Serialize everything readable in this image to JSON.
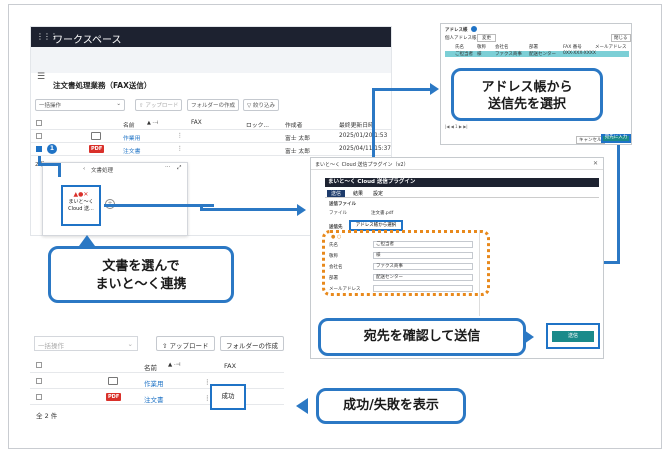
{
  "workspace": {
    "header_title": "ワークスペース",
    "page_title": "注文書処理業務（FAX送信）",
    "bulk_select": "一括操作",
    "upload_label": "アップロード",
    "create_folder_label": "フォルダーの作成",
    "filter_label": "絞り込み",
    "columns": [
      "名前",
      "FAX",
      "ロック...",
      "作成者",
      "最終更新日時"
    ],
    "rows": [
      {
        "name": "作業用",
        "fax": "",
        "creator": "富士 太郎",
        "updated": "2025/01/20 1:53"
      },
      {
        "name": "注文書",
        "fax": "",
        "creator": "富士 太郎",
        "updated": "2025/04/11 15:37"
      }
    ],
    "badge_count": "1",
    "count_partial": "2 件"
  },
  "doc_process": {
    "title": "文書処理",
    "app_label_1": "まいと～く",
    "app_label_2": "Cloud 送..."
  },
  "callouts": {
    "select_doc": [
      "文書を選んで",
      "まいと～く連携"
    ],
    "address_book": [
      "アドレス帳から",
      "送信先を選択"
    ],
    "confirm_send": "宛先を確認して送信",
    "show_result": "成功/失敗を表示"
  },
  "address_book": {
    "title": "アドレス帳",
    "group_label": "個人アドレス帳",
    "change_label": "変更",
    "close_label": "閉じる",
    "columns": [
      "氏名",
      "敬称",
      "会社名",
      "部署",
      "FAX 番号",
      "メールアドレス"
    ],
    "row": [
      "ご担当者",
      "様",
      "ファクス商事",
      "配送センター",
      "0XX-XXX-XXXX",
      ""
    ],
    "cancel_label": "キャンセル",
    "register_label": "宛先に入力"
  },
  "plugin": {
    "window_title": "まいと～く Cloud 送信プラグイン（v2）",
    "banner": "まいと～く Cloud 送信プラグイン",
    "tabs": [
      "送信",
      "結果",
      "設定"
    ],
    "send_file_heading": "送信ファイル",
    "file_label": "ファイル",
    "file_value": "注文書.pdf",
    "recipient_heading": "送信先",
    "addr_button": "アドレス帳から選択",
    "fields": [
      {
        "label": "氏名",
        "value": "ご担当者"
      },
      {
        "label": "敬称",
        "value": "様"
      },
      {
        "label": "会社名",
        "value": "ファクス商事"
      },
      {
        "label": "部署",
        "value": "配送センター"
      },
      {
        "label": "メールアドレス",
        "value": ""
      }
    ],
    "send_button": "送信"
  },
  "bottom_list": {
    "bulk_select": "一括操作",
    "upload_label": "アップロード",
    "create_folder_label": "フォルダーの作成",
    "name_col": "名前",
    "fax_col": "FAX",
    "rows": [
      {
        "name": "作業用",
        "fax": ""
      },
      {
        "name": "注文書",
        "fax": "成功"
      }
    ],
    "total": "全 2 件"
  }
}
